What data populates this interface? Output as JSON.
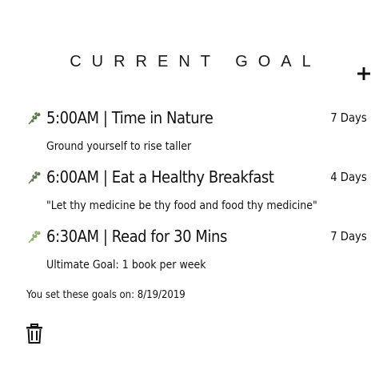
{
  "header": {
    "title": "CURRENT GOAL",
    "add_icon": "plus-icon"
  },
  "goals": [
    {
      "title": "5:00AM | Time in Nature",
      "days": "7 Days",
      "subtitle": "Ground yourself to rise taller",
      "icon": "leaf-icon",
      "icon_color": "#5a7a4a"
    },
    {
      "title": "6:00AM | Eat a Healthy Breakfast",
      "days": "4 Days",
      "subtitle": "\"Let thy medicine be thy food and food thy medicine\"",
      "icon": "leaf-icon",
      "icon_color": "#5f7b56"
    },
    {
      "title": "6:30AM | Read for 30 Mins",
      "days": "7 Days",
      "subtitle": "Ultimate Goal: 1 book per week",
      "icon": "leaf-icon",
      "icon_color": "#8bb06a"
    }
  ],
  "footer": {
    "set_date_text": "You set these goals on: 8/19/2019",
    "delete_icon": "trash-icon"
  }
}
